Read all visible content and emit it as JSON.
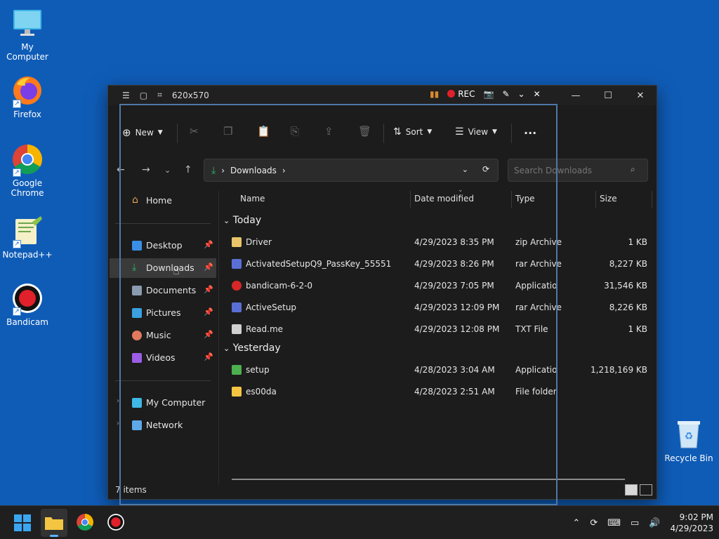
{
  "desktop": {
    "icons": [
      {
        "label": "My Computer"
      },
      {
        "label": "Firefox"
      },
      {
        "label": "Google Chrome"
      },
      {
        "label": "Notepad++"
      },
      {
        "label": "Bandicam"
      }
    ],
    "recycle_bin": "Recycle Bin"
  },
  "recorder": {
    "size_label": "620x570",
    "rec_label": "REC"
  },
  "toolbar": {
    "new_label": "New",
    "sort_label": "Sort",
    "view_label": "View",
    "more_label": "..."
  },
  "address": {
    "path": "Downloads",
    "search_placeholder": "Search Downloads"
  },
  "sidebar": {
    "home": "Home",
    "pinned": [
      {
        "label": "Desktop",
        "color": "#3a8ee6"
      },
      {
        "label": "Downloads",
        "color": "#2fb56a"
      },
      {
        "label": "Documents",
        "color": "#8a9bb0"
      },
      {
        "label": "Pictures",
        "color": "#3aa0e0"
      },
      {
        "label": "Music",
        "color": "#e07a5f"
      },
      {
        "label": "Videos",
        "color": "#9b5de5"
      }
    ],
    "bottom": [
      {
        "label": "My Computer"
      },
      {
        "label": "Network"
      }
    ]
  },
  "columns": {
    "name": "Name",
    "date": "Date modified",
    "type": "Type",
    "size": "Size"
  },
  "groups": {
    "today": "Today",
    "yesterday": "Yesterday"
  },
  "files_today": [
    {
      "name": "Driver",
      "date": "4/29/2023 8:35 PM",
      "type": "zip Archive",
      "size": "1 KB",
      "color": "#e9c46a"
    },
    {
      "name": "ActivatedSetupQ9_PassKey_55551",
      "date": "4/29/2023 8:26 PM",
      "type": "rar Archive",
      "size": "8,227 KB",
      "color": "#5a6fd6"
    },
    {
      "name": "bandicam-6-2-0",
      "date": "4/29/2023 7:05 PM",
      "type": "Application",
      "size": "31,546 KB",
      "color": "#d62828"
    },
    {
      "name": "ActiveSetup",
      "date": "4/29/2023 12:09 PM",
      "type": "rar Archive",
      "size": "8,226 KB",
      "color": "#5a6fd6"
    },
    {
      "name": "Read.me",
      "date": "4/29/2023 12:08 PM",
      "type": "TXT File",
      "size": "1 KB",
      "color": "#d0d0d0"
    }
  ],
  "files_yesterday": [
    {
      "name": "setup",
      "date": "4/28/2023 3:04 AM",
      "type": "Application",
      "size": "1,218,169 KB",
      "color": "#4caf50"
    },
    {
      "name": "es00da",
      "date": "4/28/2023 2:51 AM",
      "type": "File folder",
      "size": "",
      "color": "#f4c542"
    }
  ],
  "status": {
    "items": "7 items"
  },
  "taskbar": {
    "time": "9:02 PM",
    "date": "4/29/2023"
  }
}
